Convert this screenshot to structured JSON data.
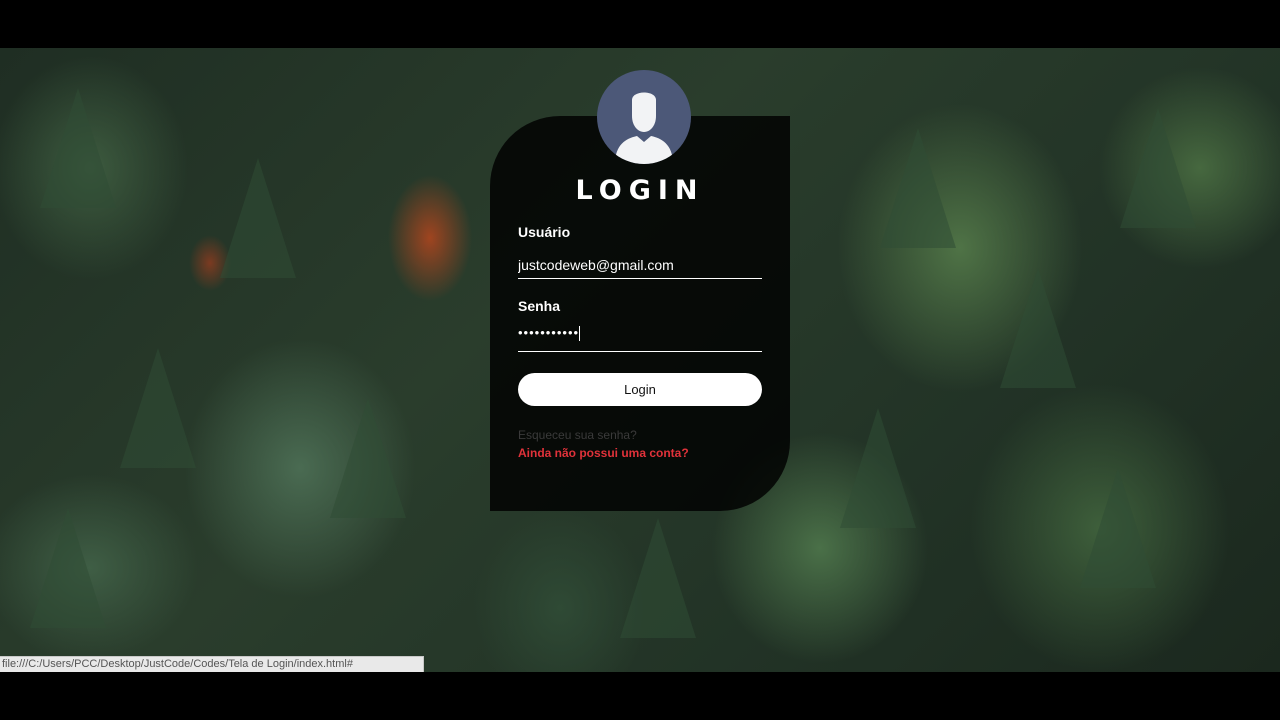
{
  "login": {
    "title": "LOGIN",
    "username_label": "Usuário",
    "username_value": "justcodeweb@gmail.com",
    "password_label": "Senha",
    "password_value": "•••••••••••",
    "button_label": "Login",
    "forgot_link": "Esqueceu sua senha?",
    "signup_link": "Ainda não possui uma conta?"
  },
  "status_bar": {
    "url": "file:///C:/Users/PCC/Desktop/JustCode/Codes/Tela de Login/index.html#"
  },
  "colors": {
    "card_bg": "#000000",
    "accent_link": "#e0323a",
    "avatar_bg": "#4c5878"
  },
  "icons": {
    "avatar": "user-silhouette-icon"
  }
}
